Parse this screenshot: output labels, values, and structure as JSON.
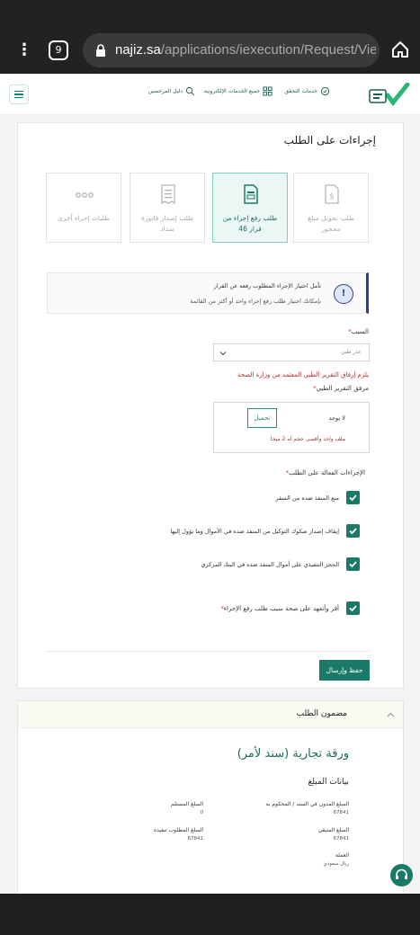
{
  "browser": {
    "tab_count": "9",
    "url_host": "najiz.sa",
    "url_path": "/applications/iexecution/Request/View?re"
  },
  "header": {
    "links": [
      {
        "label": "خدمات التحقق",
        "icon": "verify-icon"
      },
      {
        "label": "جميع الخدمات الإلكترونية",
        "icon": "grid-icon"
      },
      {
        "label": "دليل المرخصين",
        "icon": "guide-icon"
      }
    ]
  },
  "actions": {
    "title": "إجراءات على الطلب",
    "options": [
      {
        "label": "طلب تحويل مبلغ محجوز",
        "selected": false
      },
      {
        "label": "طلب رفع إجراء من قرار 46",
        "selected": true
      },
      {
        "label": "طلب إصدار فاتورة سداد",
        "selected": false
      },
      {
        "label": "طلبات إجراء أخرى",
        "selected": false
      }
    ],
    "alert_line1": "تأمل اختيار الإجراء المطلوب رفعه عن القرار",
    "alert_line2": "بإمكانك اختيار طلب رفع إجراء واحد أو أكثر من القائمة",
    "reason_label": "السبب",
    "reason_value": "عذر طبي",
    "reason_warning": "يلزم إرفاق التقرير الطبي المعتمد من وزارة الصحة",
    "attachment_label": "مرفق التقرير الطبي",
    "attachment_none": "لا يوجد",
    "upload_label": "تحميل",
    "upload_hint": "ملف واحد وأقصى حجم له 2 ميجا",
    "active_label": "الإجراءات الفعالة على الطلب",
    "active_items": [
      "منع المنفذ ضده من السفر",
      "إيقاف إصدار صكوك التوكيل من المنفذ ضده في الأموال وما يؤول إليها",
      "الحجز التنفيذي على أموال المنفذ ضده في البنك المركزي"
    ],
    "pledge": "أقر وأتعهد على صحة سبب طلب رفع الإجراء",
    "save_label": "حفظ وإرسال"
  },
  "content": {
    "section_title": "مضمون الطلب",
    "doc_title": "ورقة تجارية (سند لأمر)",
    "amount_title": "بيانات المبلغ",
    "fields": [
      {
        "label": "المبلغ المدون في السند / المحكوم به",
        "value": "67841"
      },
      {
        "label": "المبلغ المستلم",
        "value": "0"
      },
      {
        "label": "المبلغ المتبقي",
        "value": "67841"
      },
      {
        "label": "المبلغ المطلوب تنفيذه",
        "value": "67841"
      },
      {
        "label": "العملة",
        "value": "ريال سعودي"
      }
    ]
  },
  "colors": {
    "brand": "#1b7a67",
    "alert_accent": "#2c3e8c",
    "warning": "#b32b2b"
  }
}
